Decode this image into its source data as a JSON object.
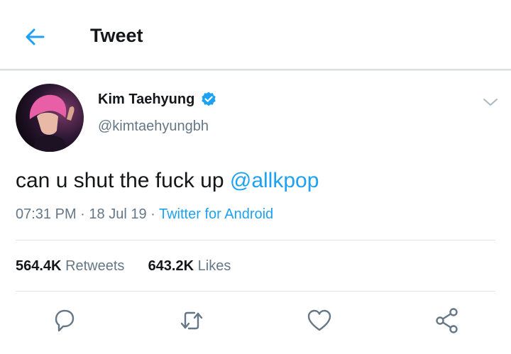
{
  "header": {
    "title": "Tweet",
    "back_icon": "arrow-left-icon"
  },
  "tweet": {
    "author_name": "Kim Taehyung",
    "author_handle": "@kimtaehyungbh",
    "verified": true,
    "text_before_mention": "can u shut the fuck up ",
    "mention": "@allkpop",
    "time": "07:31 PM",
    "date": "18 Jul 19",
    "separator": " · ",
    "source": "Twitter for Android"
  },
  "stats": {
    "retweets_count": "564.4K",
    "retweets_label": "Retweets",
    "likes_count": "643.2K",
    "likes_label": "Likes"
  },
  "actions": {
    "reply_icon": "reply-icon",
    "retweet_icon": "retweet-icon",
    "like_icon": "heart-icon",
    "share_icon": "share-icon"
  },
  "colors": {
    "accent": "#1da1f2",
    "secondary_text": "#657786",
    "primary_text": "#14171a",
    "divider": "#dfe3e6"
  }
}
